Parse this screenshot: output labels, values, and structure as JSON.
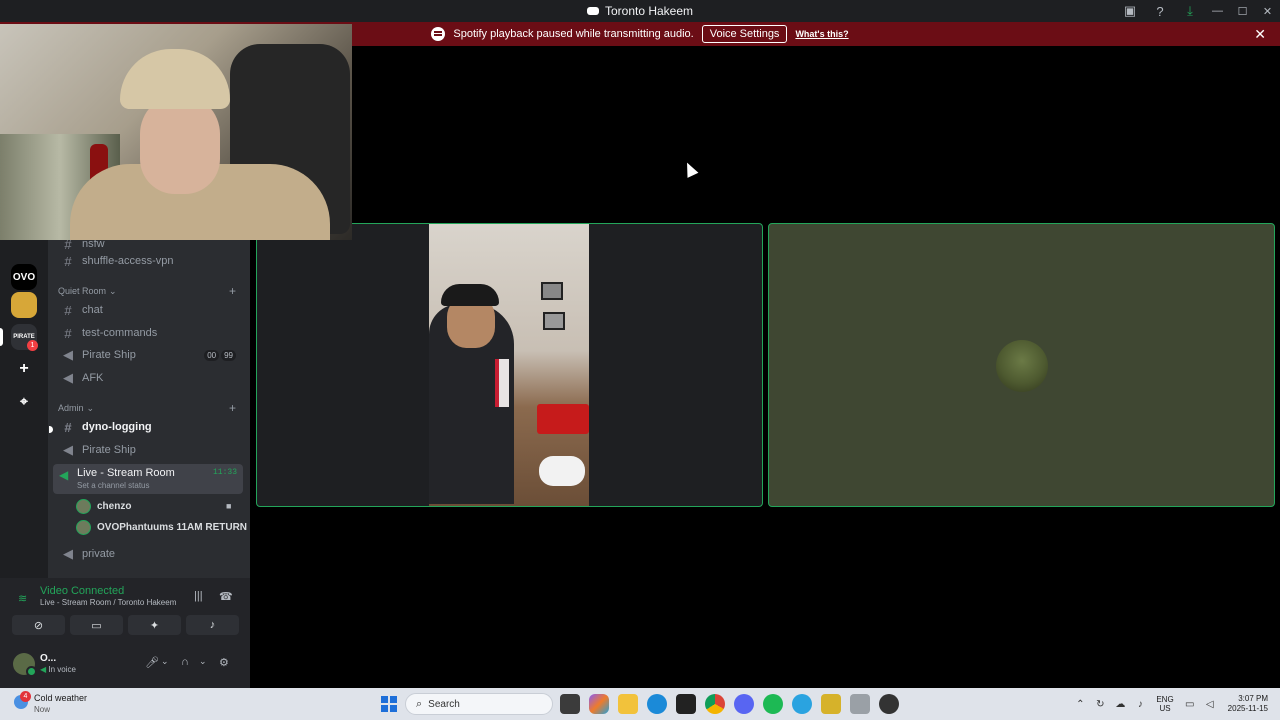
{
  "window": {
    "title": "Toronto Hakeem"
  },
  "titlebar_icons": [
    "inbox-icon",
    "help-icon",
    "download-icon"
  ],
  "window_controls": {
    "minimize": "—",
    "maximize": "☐",
    "close": "✕"
  },
  "banner": {
    "message": "Spotify playback paused while transmitting audio.",
    "button": "Voice Settings",
    "link": "What's this?",
    "close": "✕"
  },
  "rail": {
    "servers": [
      {
        "label": "OVO",
        "color": "#000000"
      },
      {
        "label": "",
        "color": "#d7a738"
      },
      {
        "label": "PIRATE",
        "color": "#2f3136"
      }
    ],
    "badge": "1",
    "add": "+",
    "explore": "⌖"
  },
  "channels": {
    "top_partial": "nsfw",
    "shuffle": "shuffle-access-vpn",
    "quiet_room": {
      "name": "Quiet Room",
      "items": [
        {
          "type": "text",
          "name": "chat"
        },
        {
          "type": "text",
          "name": "test-commands"
        },
        {
          "type": "voice",
          "name": "Pirate Ship",
          "counts": [
            "00",
            "99"
          ]
        },
        {
          "type": "voice",
          "name": "AFK"
        }
      ]
    },
    "admin": {
      "name": "Admin",
      "items": [
        {
          "type": "text",
          "name": "dyno-logging"
        },
        {
          "type": "voice",
          "name": "Pirate Ship"
        }
      ]
    },
    "live_room": {
      "name": "Live - Stream Room",
      "status": "Set a channel status",
      "timer": "11:33",
      "users": [
        "chenzo",
        "OVOPhantuums 11AM RETURN"
      ]
    },
    "private": "private"
  },
  "voice": {
    "status": "Video Connected",
    "location": "Live - Stream Room / Toronto Hakeem"
  },
  "user": {
    "name": "O...",
    "status": "In voice"
  },
  "taskbar": {
    "weather_title": "Cold weather",
    "weather_sub": "Now",
    "weather_badge": "4",
    "search_placeholder": "Search",
    "lang_top": "ENG",
    "lang_bottom": "US",
    "time": "3:07 PM",
    "date": "2025-11-15"
  }
}
